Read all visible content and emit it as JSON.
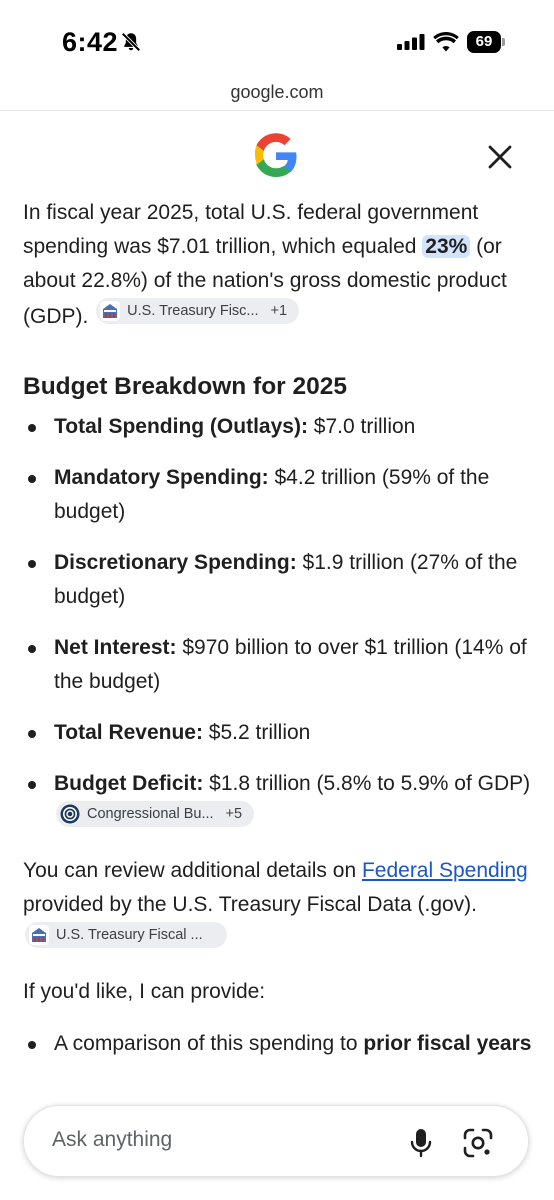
{
  "status_bar": {
    "time": "6:42",
    "battery": "69"
  },
  "url_bar": {
    "domain": "google.com"
  },
  "intro": {
    "text_before": "In fiscal year 2025, total U.S. federal government spending was $7.01 trillion, which equaled ",
    "highlight": "23%",
    "text_after": " (or about 22.8%) of the nation's gross domestic product (GDP). ",
    "source_chip": {
      "name": "U.S. Treasury Fisc...",
      "count": "+1"
    }
  },
  "section_heading": "Budget Breakdown for 2025",
  "bullets": [
    {
      "label": "Total Spending (Outlays):",
      "text": " $7.0 trillion"
    },
    {
      "label": "Mandatory Spending:",
      "text": " $4.2 trillion (59% of the budget)"
    },
    {
      "label": "Discretionary Spending:",
      "text": " $1.9 trillion (27% of the budget)"
    },
    {
      "label": "Net Interest:",
      "text": " $970 billion to over $1 trillion (14% of the budget)"
    },
    {
      "label": "Total Revenue:",
      "text": " $5.2 trillion"
    },
    {
      "label": "Budget Deficit:",
      "text": " $1.8 trillion (5.8% to 5.9% of GDP) ",
      "chip": {
        "name": "Congressional Bu...",
        "count": "+5"
      }
    }
  ],
  "review": {
    "before": "You can review additional details on ",
    "link": "Federal Spending",
    "after": " provided by the U.S. Treasury Fiscal Data (.gov). ",
    "chip": {
      "name": "U.S. Treasury Fiscal ..."
    }
  },
  "offer": {
    "text": "If you'd like, I can provide:",
    "item_before": "A comparison of this spending to ",
    "item_bold": "prior fiscal years"
  },
  "ask": {
    "placeholder": "Ask anything"
  },
  "colors": {
    "link": "#1a56c7",
    "highlight": "#d3e3fd",
    "chip_bg": "#ecedf1"
  },
  "icons": [
    "bell-slash-icon",
    "signal-icon",
    "wifi-icon",
    "battery-icon",
    "google-g-icon",
    "close-icon",
    "treasury-icon",
    "cbo-icon",
    "microphone-icon",
    "google-lens-icon"
  ]
}
